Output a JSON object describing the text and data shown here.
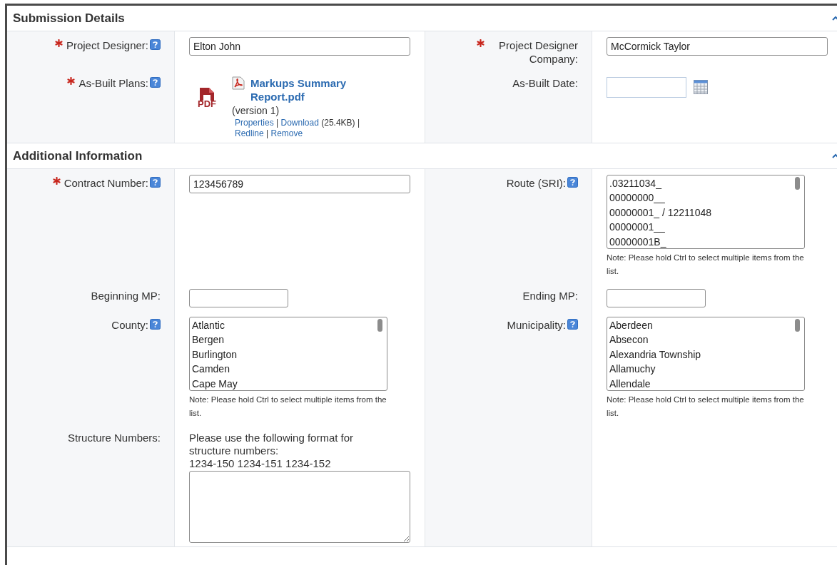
{
  "sections": [
    {
      "title": "Submission Details",
      "expanded": true,
      "rows": [
        {
          "left": {
            "label": "Project Designer:",
            "required": true,
            "help": true,
            "kind": "text",
            "value": "Elton John"
          },
          "right": {
            "label": "Project Designer Company:",
            "required": true,
            "help": false,
            "kind": "text",
            "value": "McCormick Taylor"
          }
        },
        {
          "left": {
            "label": "As-Built Plans:",
            "required": true,
            "help": true,
            "kind": "file",
            "badge": "PDF",
            "file_name": "Markups Summary Report.pdf",
            "version": "(version 1)",
            "actions": [
              {
                "kind": "link",
                "text": "Properties"
              },
              {
                "kind": "text",
                "text": "|"
              },
              {
                "kind": "link",
                "text": "Download"
              },
              {
                "kind": "text",
                "text": "(25.4KB)"
              },
              {
                "kind": "text",
                "text": "|"
              },
              {
                "kind": "link",
                "text": "Redline"
              },
              {
                "kind": "text",
                "text": "|"
              },
              {
                "kind": "link",
                "text": "Remove"
              }
            ]
          },
          "right": {
            "label": "As-Built Date:",
            "required": false,
            "help": false,
            "kind": "date"
          }
        }
      ]
    },
    {
      "title": "Additional Information",
      "expanded": true,
      "rows": [
        {
          "left": {
            "label": "Contract Number:",
            "required": true,
            "help": true,
            "kind": "text",
            "value": "123456789"
          },
          "right": {
            "label": "Route (SRI):",
            "required": false,
            "help": true,
            "kind": "listbox",
            "items": [
              {
                "text": ".03211034_",
                "selected": false
              },
              {
                "text": "00000000__",
                "selected": false
              },
              {
                "text": "00000001_ / 12211048",
                "selected": false
              },
              {
                "text": "00000001__",
                "selected": false
              },
              {
                "text": "00000001B_",
                "selected": false
              }
            ],
            "note": "Note: Please hold Ctrl to select multiple items from the list."
          }
        },
        {
          "left": {
            "label": "Beginning MP:",
            "required": false,
            "help": false,
            "kind": "short_text"
          },
          "right": {
            "label": "Ending MP:",
            "required": false,
            "help": false,
            "kind": "short_text"
          }
        },
        {
          "left": {
            "label": "County:",
            "required": false,
            "help": true,
            "kind": "listbox",
            "items": [
              {
                "text": "Atlantic",
                "selected": false
              },
              {
                "text": "Bergen",
                "selected": false
              },
              {
                "text": "Burlington",
                "selected": false
              },
              {
                "text": "Camden",
                "selected": false
              },
              {
                "text": "Cape May",
                "selected": false
              }
            ],
            "note": "Note: Please hold Ctrl to select multiple items from the list."
          },
          "right": {
            "label": "Municipality:",
            "required": false,
            "help": true,
            "kind": "listbox",
            "items": [
              {
                "text": "Aberdeen",
                "selected": false
              },
              {
                "text": "Absecon",
                "selected": false
              },
              {
                "text": "Alexandria Township",
                "selected": false
              },
              {
                "text": "Allamuchy",
                "selected": false
              },
              {
                "text": "Allendale",
                "selected": false
              }
            ],
            "note": "Note: Please hold Ctrl to select multiple items from the list."
          }
        },
        {
          "left": {
            "label": "Structure Numbers:",
            "required": false,
            "help": false,
            "kind": "textarea",
            "hint": "Please use the following format for structure numbers:",
            "example": "1234-150 1234-151 1234-152"
          },
          "right": null
        }
      ]
    }
  ]
}
